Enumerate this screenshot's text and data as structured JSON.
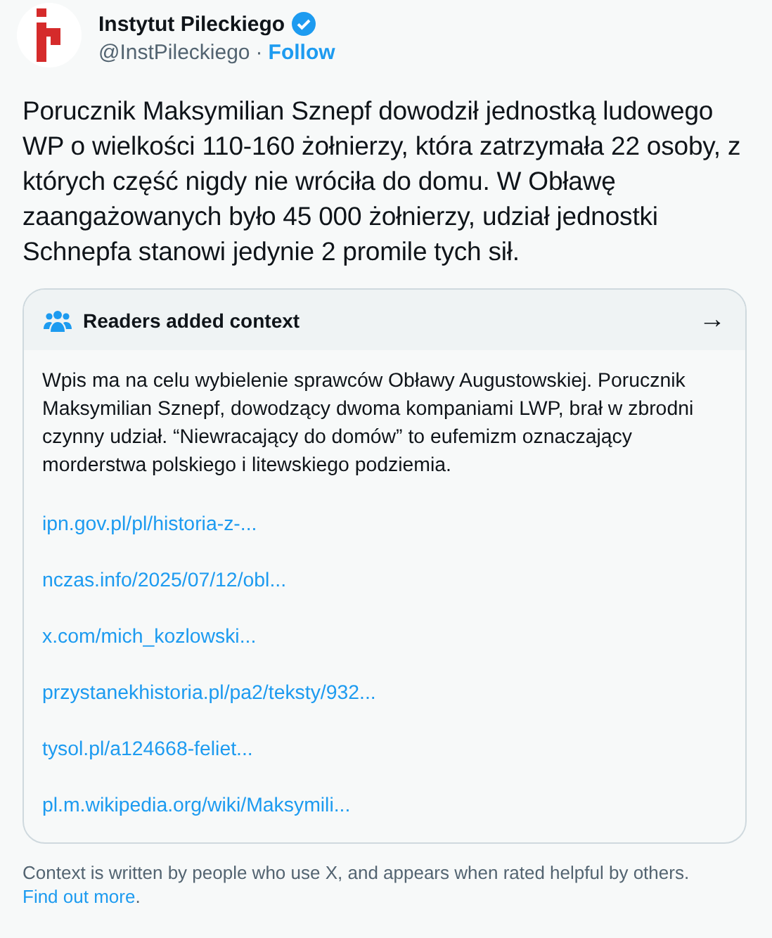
{
  "author": {
    "name": "Instytut Pileckiego",
    "verified": true,
    "handle": "@InstPileckiego",
    "separator": "·",
    "follow": "Follow"
  },
  "tweet_text": "Porucznik Maksymilian Sznepf dowodził jednostką ludowego WP o wielkości 110-160 żołnierzy, która zatrzymała 22 osoby, z których część nigdy nie wróciła do domu. W Obławę zaangażowanych było 45 000 żołnierzy, udział jednostki Schnepfa stanowi jedynie 2 promile tych sił.",
  "context_note": {
    "title": "Readers added context",
    "arrow": "→",
    "text": "Wpis ma na celu wybielenie sprawców Obławy Augustowskiej. Porucznik Maksymilian Sznepf, dowodzący dwoma kompaniami LWP, brał w zbrodni czynny udział. “Niewracający do domów” to eufemizm oznaczający morderstwa polskiego i litewskiego podziemia.",
    "links": [
      "ipn.gov.pl/pl/historia-z-...",
      "nczas.info/2025/07/12/obl...",
      "x.com/mich_kozlowski...",
      "przystanekhistoria.pl/pa2/teksty/932...",
      "tysol.pl/a124668-feliet...",
      "pl.m.wikipedia.org/wiki/Maksymili..."
    ]
  },
  "footer": {
    "text": "Context is written by people who use X, and appears when rated helpful by others.",
    "link": "Find out more",
    "end": "."
  }
}
